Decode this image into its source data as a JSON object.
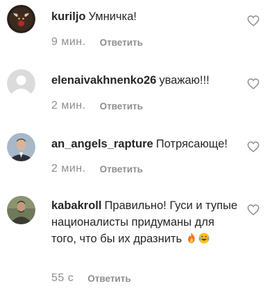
{
  "comments": [
    {
      "username": "kuriljo",
      "text": "Умничка!",
      "time": "9 мин.",
      "reply_label": "Ответить",
      "avatar_icon": "bull-logo-avatar",
      "like_icon": "heart-outline-icon"
    },
    {
      "username": "elenaivakhnenko26",
      "text": "уважаю!!!",
      "time": "2 мин.",
      "reply_label": "Ответить",
      "avatar_icon": "default-user-avatar",
      "like_icon": "heart-outline-icon"
    },
    {
      "username": "an_angels_rapture",
      "text": "Потрясающе!",
      "time": "2 мин.",
      "reply_label": "Ответить",
      "avatar_icon": "man-in-suit-avatar",
      "like_icon": "heart-outline-icon"
    },
    {
      "username": "kabakroll",
      "text": "Правильно! Гуси и тупые националисты придуманы для того, что бы их дразнить",
      "emojis": [
        "fire-emoji",
        "tears-of-joy-emoji"
      ],
      "time": "55 с",
      "reply_label": "Ответить",
      "avatar_icon": "man-photo-avatar",
      "like_icon": "heart-outline-icon"
    }
  ],
  "colors": {
    "text": "#262626",
    "secondary": "#8e8e8e",
    "background": "#ffffff"
  }
}
